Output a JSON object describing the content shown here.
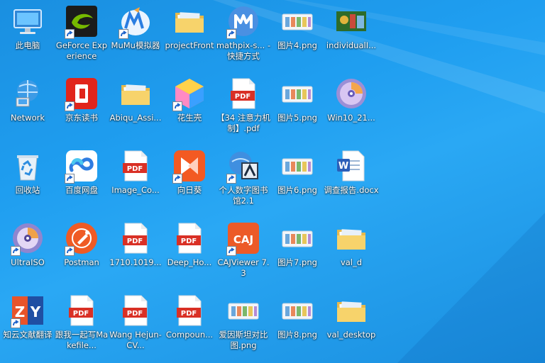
{
  "desktop": {
    "icons": [
      {
        "label": "此电脑",
        "icon": "this-pc-icon",
        "col": 0,
        "row": 0,
        "shortcut": false
      },
      {
        "label": "GeForce Experience",
        "icon": "geforce-experience-icon",
        "col": 1,
        "row": 0,
        "shortcut": true
      },
      {
        "label": "MuMu模拟器",
        "icon": "mumu-emulator-icon",
        "col": 2,
        "row": 0,
        "shortcut": true
      },
      {
        "label": "projectFront",
        "icon": "folder-icon",
        "col": 3,
        "row": 0,
        "shortcut": false
      },
      {
        "label": "mathpix-s... - 快捷方式",
        "icon": "mathpix-icon",
        "col": 4,
        "row": 0,
        "shortcut": true
      },
      {
        "label": "图片4.png",
        "icon": "image-file-icon",
        "col": 5,
        "row": 0,
        "shortcut": false
      },
      {
        "label": "individualI...",
        "icon": "photo-file-icon",
        "col": 6,
        "row": 0,
        "shortcut": false
      },
      {
        "label": "Network",
        "icon": "network-icon",
        "col": 0,
        "row": 1,
        "shortcut": false
      },
      {
        "label": "京东读书",
        "icon": "jd-reader-icon",
        "col": 1,
        "row": 1,
        "shortcut": true
      },
      {
        "label": "Abiqu_Assi...",
        "icon": "folder-icon",
        "col": 2,
        "row": 1,
        "shortcut": false
      },
      {
        "label": "花生壳",
        "icon": "peanut-shell-icon",
        "col": 3,
        "row": 1,
        "shortcut": true
      },
      {
        "label": "【34 注意力机制】.pdf",
        "icon": "pdf-icon",
        "col": 4,
        "row": 1,
        "shortcut": false
      },
      {
        "label": "图片5.png",
        "icon": "image-file-icon",
        "col": 5,
        "row": 1,
        "shortcut": false
      },
      {
        "label": "Win10_21...",
        "icon": "disc-image-icon",
        "col": 6,
        "row": 1,
        "shortcut": false
      },
      {
        "label": "回收站",
        "icon": "recycle-bin-icon",
        "col": 0,
        "row": 2,
        "shortcut": false
      },
      {
        "label": "百度网盘",
        "icon": "baidu-netdisk-icon",
        "col": 1,
        "row": 2,
        "shortcut": true
      },
      {
        "label": "Image_Co...",
        "icon": "pdf-icon",
        "col": 2,
        "row": 2,
        "shortcut": false
      },
      {
        "label": "向日葵",
        "icon": "sunlogin-icon",
        "col": 3,
        "row": 2,
        "shortcut": true
      },
      {
        "label": "个人数字图书馆2.1",
        "icon": "digital-library-icon",
        "col": 4,
        "row": 2,
        "shortcut": true
      },
      {
        "label": "图片6.png",
        "icon": "image-file-icon",
        "col": 5,
        "row": 2,
        "shortcut": false
      },
      {
        "label": "调查报告.docx",
        "icon": "word-doc-icon",
        "col": 6,
        "row": 2,
        "shortcut": false
      },
      {
        "label": "UltraISO",
        "icon": "ultraiso-icon",
        "col": 0,
        "row": 3,
        "shortcut": true
      },
      {
        "label": "Postman",
        "icon": "postman-icon",
        "col": 1,
        "row": 3,
        "shortcut": true
      },
      {
        "label": "1710.1019...",
        "icon": "pdf-icon",
        "col": 2,
        "row": 3,
        "shortcut": false
      },
      {
        "label": "Deep_Ho...",
        "icon": "pdf-icon",
        "col": 3,
        "row": 3,
        "shortcut": false
      },
      {
        "label": "CAJViewer 7.3",
        "icon": "cajviewer-icon",
        "col": 4,
        "row": 3,
        "shortcut": true
      },
      {
        "label": "图片7.png",
        "icon": "image-file-icon",
        "col": 5,
        "row": 3,
        "shortcut": false
      },
      {
        "label": "val_d",
        "icon": "folder-icon",
        "col": 6,
        "row": 3,
        "shortcut": false
      },
      {
        "label": "知云文献翻译",
        "icon": "zhiyun-translate-icon",
        "col": 0,
        "row": 4,
        "shortcut": true
      },
      {
        "label": "跟我一起写Makefile...",
        "icon": "pdf-icon",
        "col": 1,
        "row": 4,
        "shortcut": false
      },
      {
        "label": "Wang Hejun-CV...",
        "icon": "pdf-icon",
        "col": 2,
        "row": 4,
        "shortcut": false
      },
      {
        "label": "Compoun...",
        "icon": "pdf-icon",
        "col": 3,
        "row": 4,
        "shortcut": false
      },
      {
        "label": "爱因斯坦对比图.png",
        "icon": "image-file-icon",
        "col": 4,
        "row": 4,
        "shortcut": false
      },
      {
        "label": "图片8.png",
        "icon": "image-file-icon",
        "col": 5,
        "row": 4,
        "shortcut": false
      },
      {
        "label": "val_desktop",
        "icon": "folder-icon",
        "col": 6,
        "row": 4,
        "shortcut": false
      }
    ]
  }
}
